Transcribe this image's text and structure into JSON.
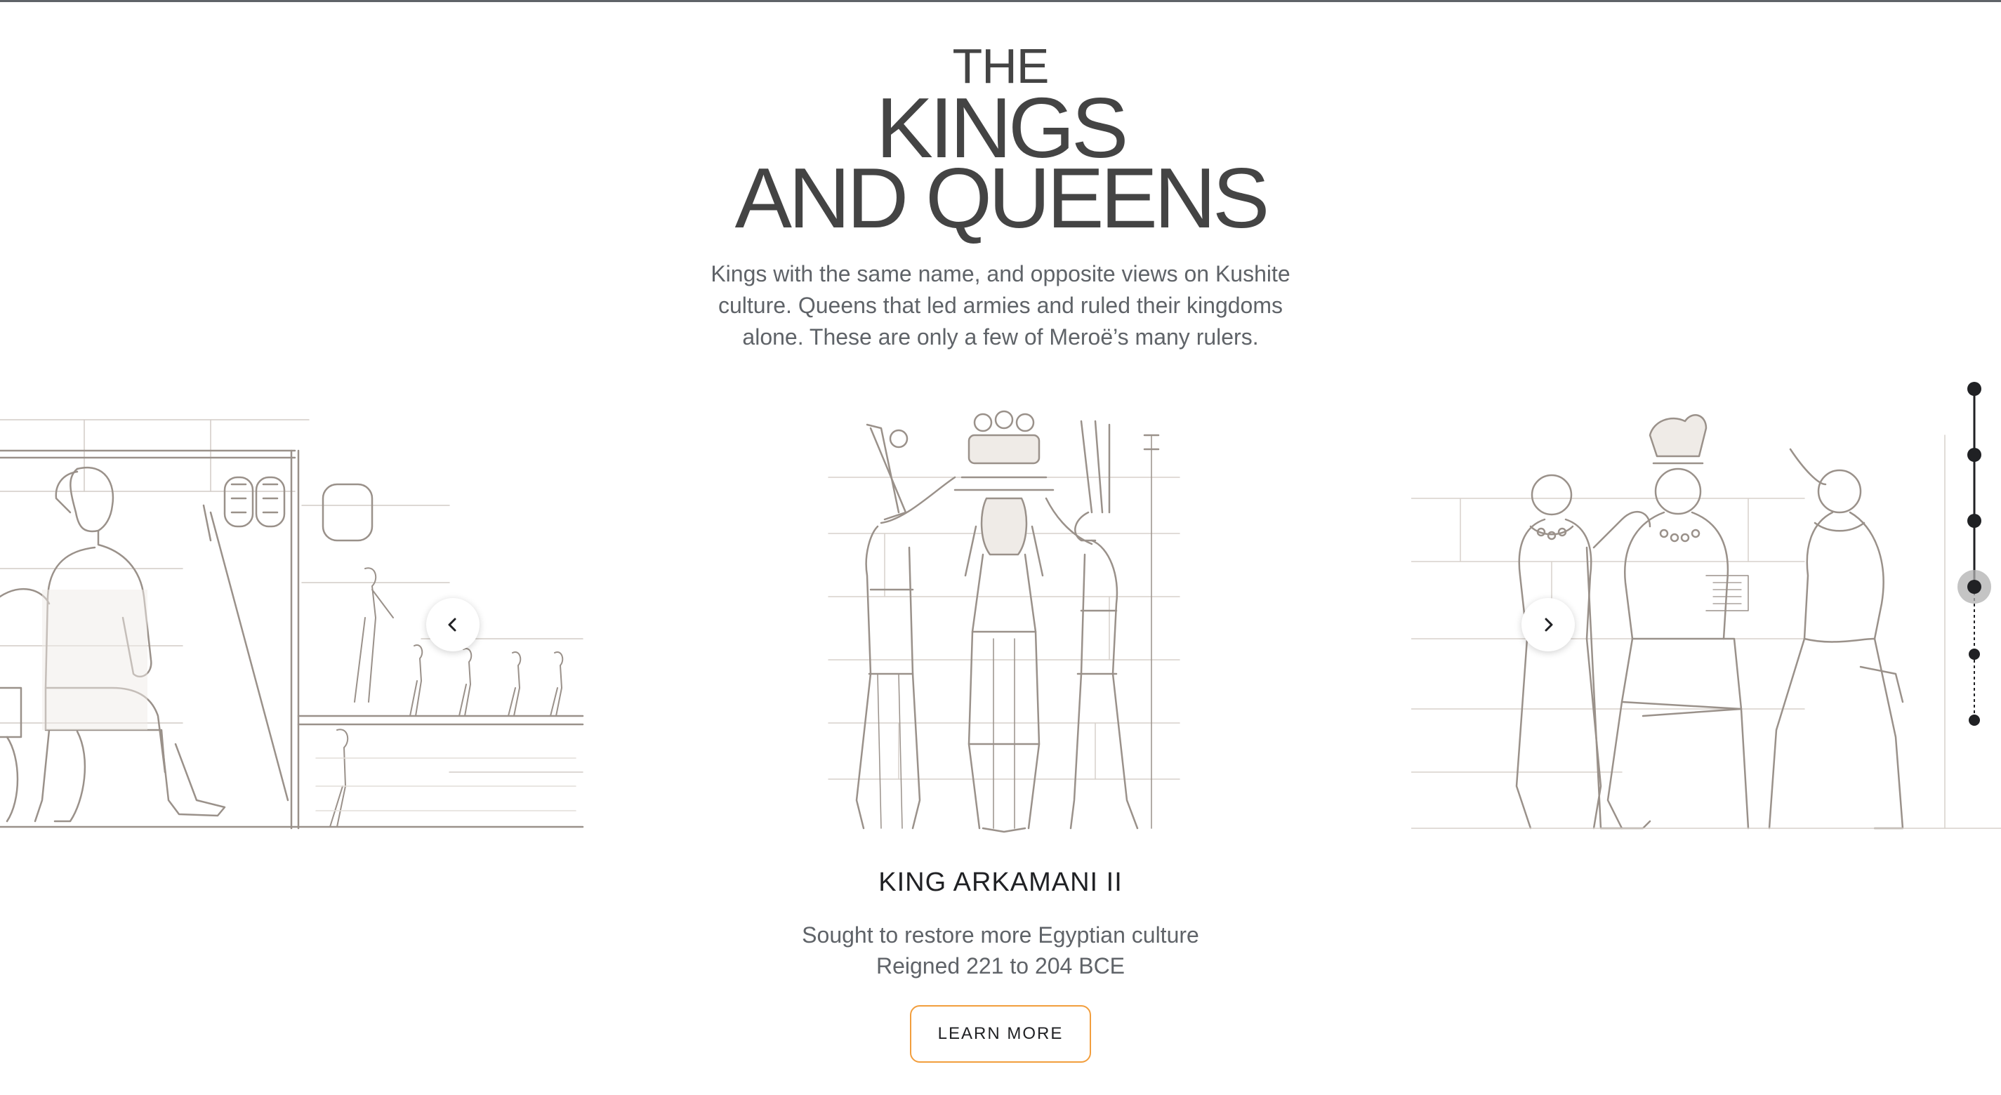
{
  "hero": {
    "title_line1": "THE",
    "title_line2": "KINGS",
    "title_line3": "AND QUEENS",
    "intro": "Kings with the same name, and opposite views on Kushite culture. Queens that led armies and ruled their kingdoms alone. These are only a few of Meroë’s many rulers."
  },
  "carousel": {
    "prev_icon": "chevron-left-icon",
    "next_icon": "chevron-right-icon",
    "active": {
      "name": "KING ARKAMANI II",
      "description": "Sought to restore more Egyptian culture",
      "reign": "Reigned 221 to 204 BCE",
      "button_label": "LEARN MORE"
    }
  },
  "timeline": {
    "total_stops": 6,
    "active_stop": 4
  },
  "colors": {
    "title": "#444444",
    "text": "#5f6368",
    "heading": "#202124",
    "button_border": "#f29e3d",
    "illustration_line": "#9a918a",
    "illustration_fill": "#efebe7"
  }
}
